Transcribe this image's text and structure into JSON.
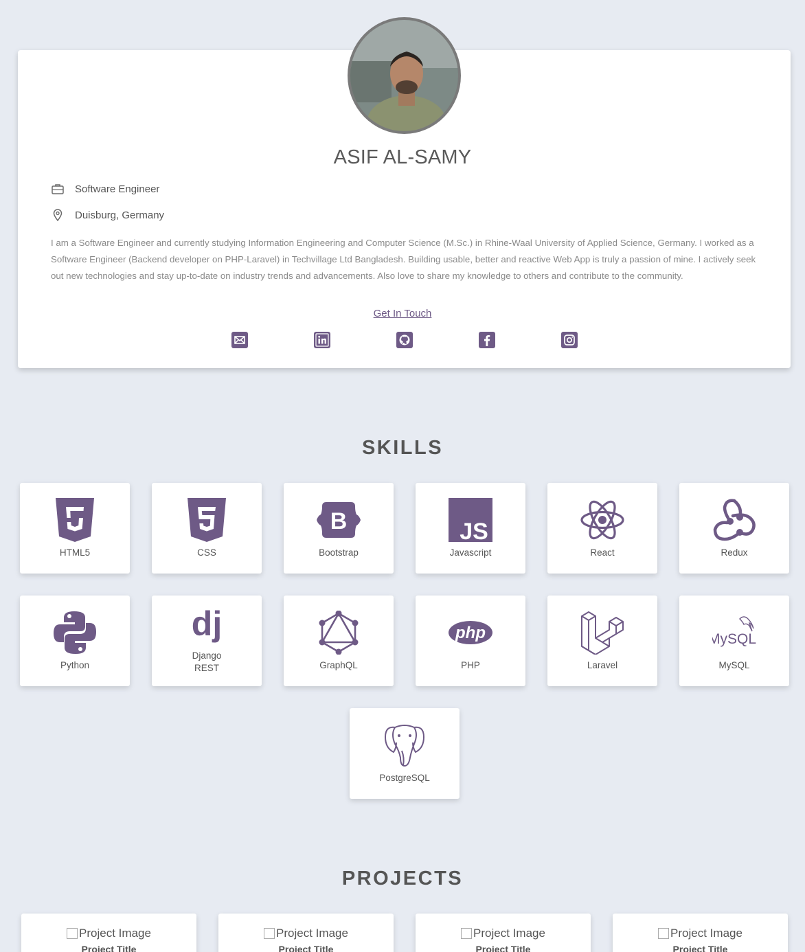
{
  "profile": {
    "name": "ASIF AL-SAMY",
    "title": "Software Engineer",
    "location": "Duisburg, Germany",
    "bio": "I am a Software Engineer and currently studying Information Engineering and Computer Science (M.Sc.) in Rhine-Waal University of Applied Science, Germany. I worked as a Software Engineer (Backend developer on PHP-Laravel) in Techvillage Ltd Bangladesh. Building usable, better and reactive Web App is truly a passion of mine. I actively seek out new technologies and stay up-to-date on industry trends and advancements. Also love to share my knowledge to others and contribute to the community.",
    "cta": "Get In Touch",
    "social": [
      "email-icon",
      "linkedin-icon",
      "github-icon",
      "facebook-icon",
      "instagram-icon"
    ]
  },
  "skills": {
    "title": "SKILLS",
    "items": [
      {
        "label": "HTML5",
        "icon": "html5-icon"
      },
      {
        "label": "CSS",
        "icon": "css3-icon"
      },
      {
        "label": "Bootstrap",
        "icon": "bootstrap-icon"
      },
      {
        "label": "Javascript",
        "icon": "javascript-icon"
      },
      {
        "label": "React",
        "icon": "react-icon"
      },
      {
        "label": "Redux",
        "icon": "redux-icon"
      },
      {
        "label": "Python",
        "icon": "python-icon"
      },
      {
        "label": "Django\nREST",
        "icon": "django-icon"
      },
      {
        "label": "GraphQL",
        "icon": "graphql-icon"
      },
      {
        "label": "PHP",
        "icon": "php-icon"
      },
      {
        "label": "Laravel",
        "icon": "laravel-icon"
      },
      {
        "label": "MySQL",
        "icon": "mysql-icon"
      },
      {
        "label": "PostgreSQL",
        "icon": "postgresql-icon"
      }
    ]
  },
  "projects": {
    "title": "PROJECTS",
    "items": [
      {
        "image_alt": "Project Image",
        "title": "Project Title"
      },
      {
        "image_alt": "Project Image",
        "title": "Project Title"
      },
      {
        "image_alt": "Project Image",
        "title": "Project Title"
      },
      {
        "image_alt": "Project Image",
        "title": "Project Title"
      }
    ]
  },
  "colors": {
    "accent": "#6e5a86",
    "background": "#e7ebf2",
    "card": "#ffffff",
    "text": "#555555"
  }
}
